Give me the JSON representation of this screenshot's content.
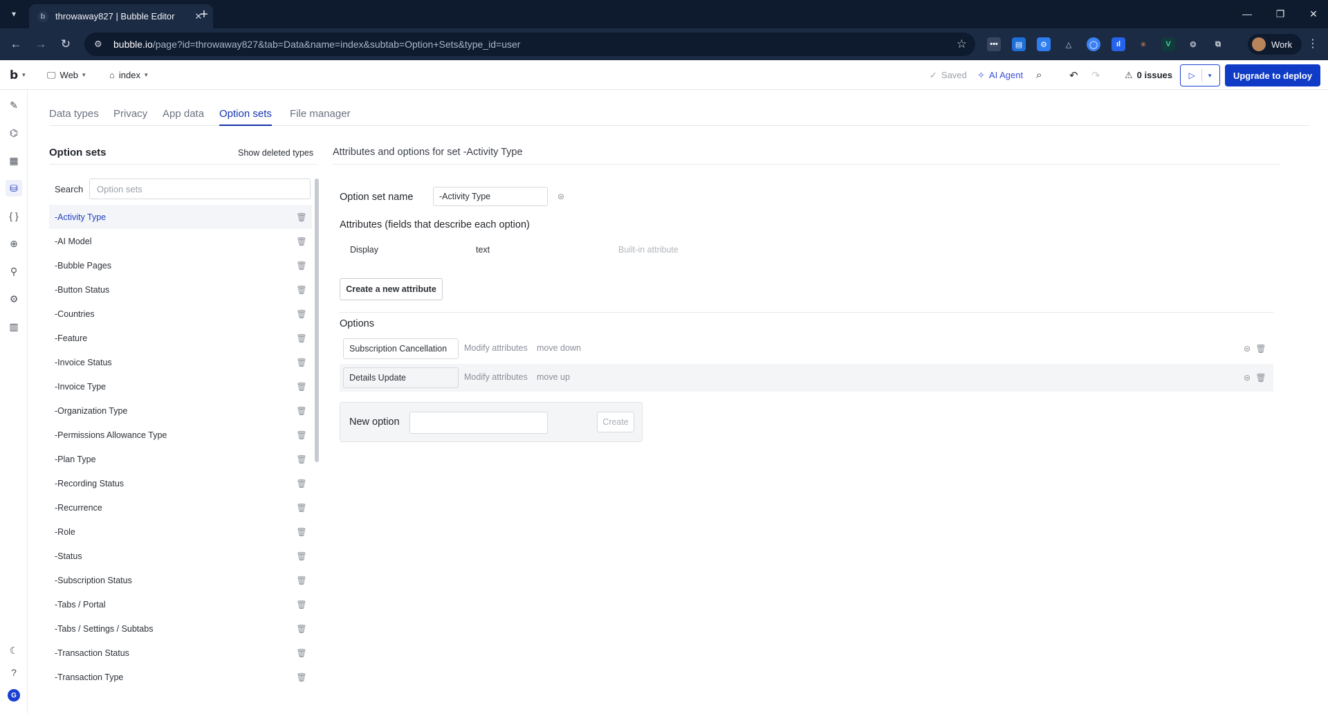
{
  "browser": {
    "tab_title": "throwaway827 | Bubble Editor",
    "url_host": "bubble.io",
    "url_path": "/page?id=throwaway827&tab=Data&name=index&subtab=Option+Sets&type_id=user",
    "profile_name": "Work"
  },
  "editor_bar": {
    "platform": "Web",
    "page": "index",
    "saved_label": "Saved",
    "ai_agent_label": "AI Agent",
    "issues_label": "0 issues",
    "deploy_label": "Upgrade to deploy",
    "accent_color": "#0f3bc7"
  },
  "subtabs": [
    "Data types",
    "Privacy",
    "App data",
    "Option sets",
    "File manager"
  ],
  "active_subtab": "Option sets",
  "left_panel": {
    "title": "Option sets",
    "show_deleted_label": "Show deleted types",
    "search_label": "Search",
    "search_placeholder": "Option sets",
    "items": [
      "-Activity Type",
      "-AI Model",
      "-Bubble Pages",
      "-Button Status",
      "-Countries",
      "-Feature",
      "-Invoice Status",
      "-Invoice Type",
      "-Organization Type",
      "-Permissions Allowance Type",
      "-Plan Type",
      "-Recording Status",
      "-Recurrence",
      "-Role",
      "-Status",
      "-Subscription Status",
      "-Tabs / Portal",
      "-Tabs / Settings / Subtabs",
      "-Transaction Status",
      "-Transaction Type"
    ],
    "selected_item": "-Activity Type"
  },
  "right_panel": {
    "title": "Attributes and options for set -Activity Type",
    "option_set_name_label": "Option set name",
    "option_set_name_value": "-Activity Type",
    "attributes_heading": "Attributes (fields that describe each option)",
    "attributes": [
      {
        "name": "Display",
        "type": "text",
        "note": "Built-in attribute"
      }
    ],
    "create_attribute_label": "Create a new attribute",
    "options_heading": "Options",
    "options": [
      {
        "value": "Subscription Cancellation",
        "modify": "Modify attributes",
        "move": "move down"
      },
      {
        "value": "Details Update",
        "modify": "Modify attributes",
        "move": "move up"
      }
    ],
    "new_option_label": "New option",
    "create_label": "Create"
  }
}
